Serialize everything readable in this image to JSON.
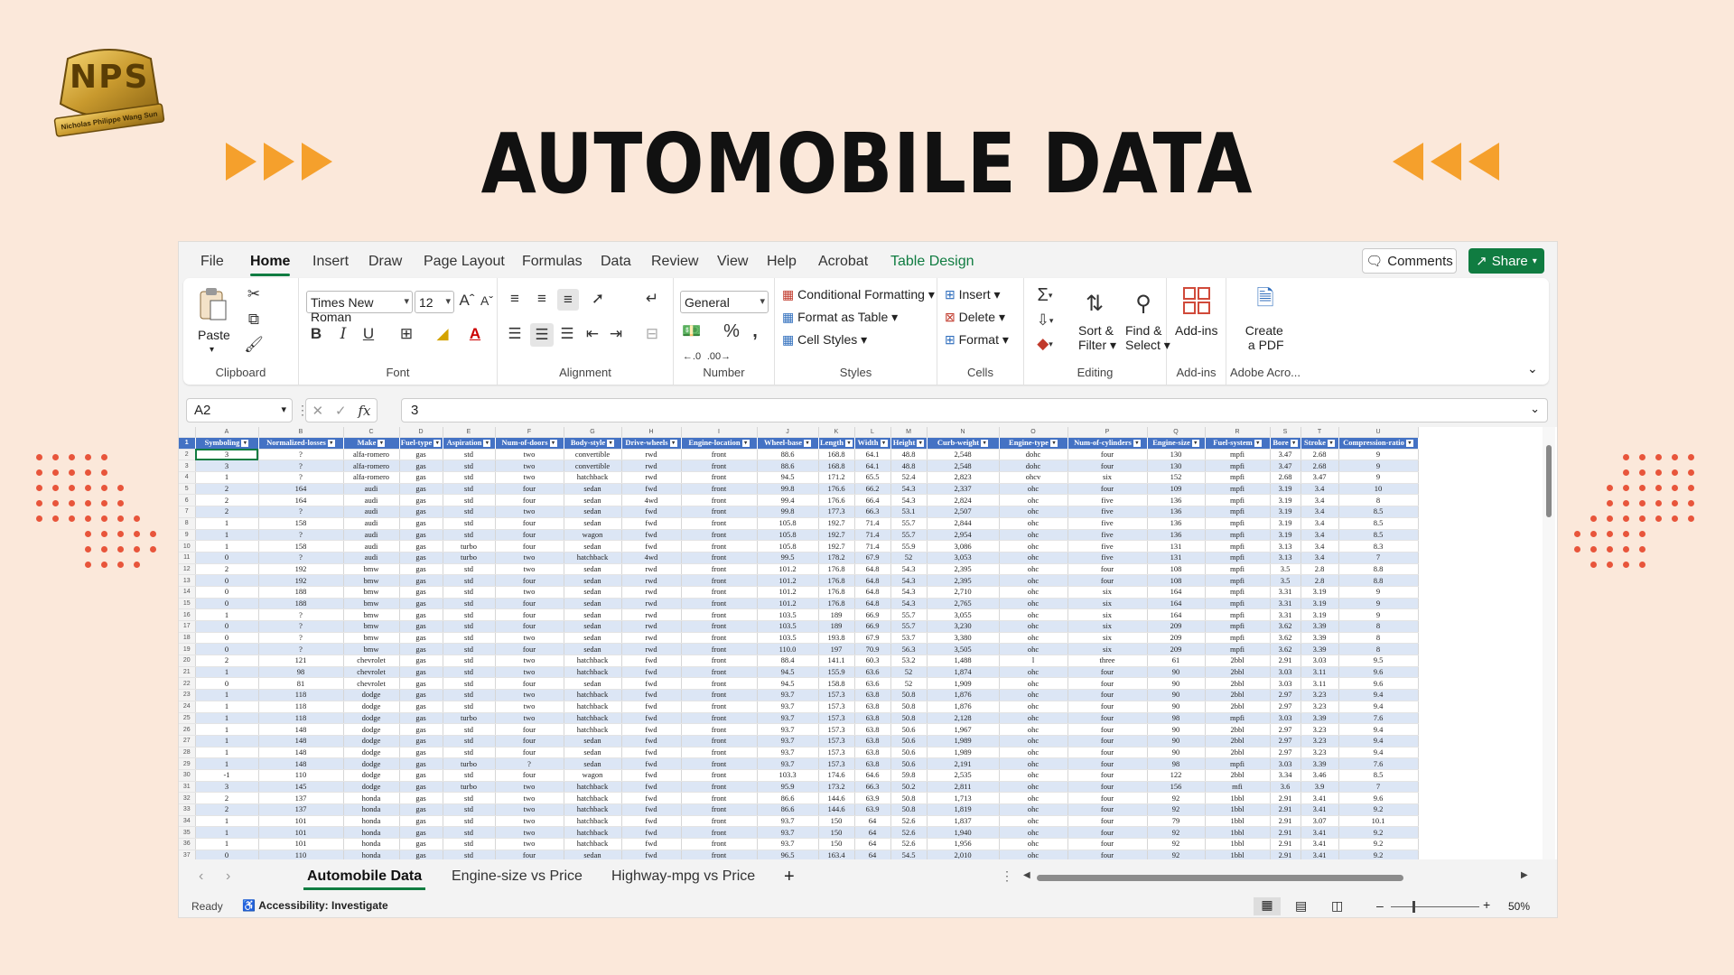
{
  "banner": {
    "title": "AUTOMOBILE DATA",
    "logo_text": "Nicholas Philippe Wang Sun",
    "logo_monogram": "NPS"
  },
  "menu": {
    "items": [
      "File",
      "Home",
      "Insert",
      "Draw",
      "Page Layout",
      "Formulas",
      "Data",
      "Review",
      "View",
      "Help",
      "Acrobat",
      "Table Design"
    ],
    "active": "Home",
    "comments_label": "Comments",
    "share_label": "Share"
  },
  "ribbon": {
    "clipboard": {
      "paste_label": "Paste",
      "group_label": "Clipboard"
    },
    "font": {
      "family": "Times New Roman",
      "size": "12",
      "group_label": "Font"
    },
    "alignment": {
      "group_label": "Alignment"
    },
    "number": {
      "format": "General",
      "group_label": "Number"
    },
    "styles": {
      "conditional": "Conditional Formatting",
      "format_table": "Format as Table",
      "cell_styles": "Cell Styles",
      "group_label": "Styles"
    },
    "cells": {
      "insert": "Insert",
      "delete": "Delete",
      "format": "Format",
      "group_label": "Cells"
    },
    "editing": {
      "sort_filter_1": "Sort &",
      "sort_filter_2": "Filter",
      "find_select_1": "Find &",
      "find_select_2": "Select",
      "group_label": "Editing"
    },
    "addins": {
      "label": "Add-ins",
      "group_label": "Add-ins"
    },
    "adobe": {
      "label1": "Create",
      "label2": "a PDF",
      "group_label": "Adobe Acro..."
    }
  },
  "formula_bar": {
    "name_box": "A2",
    "value": "3"
  },
  "grid": {
    "column_letters": [
      "A",
      "B",
      "C",
      "D",
      "E",
      "F",
      "G",
      "H",
      "I",
      "J",
      "K",
      "L",
      "M",
      "N",
      "O",
      "P",
      "Q",
      "R",
      "S",
      "T",
      "U"
    ],
    "headers": [
      "Symboling",
      "Normalized-losses",
      "Make",
      "Fuel-type",
      "Aspiration",
      "Num-of-doors",
      "Body-style",
      "Drive-wheels",
      "Engine-location",
      "Wheel-base",
      "Length",
      "Width",
      "Height",
      "Curb-weight",
      "Engine-type",
      "Num-of-cylinders",
      "Engine-size",
      "Fuel-system",
      "Bore",
      "Stroke",
      "Compression-ratio"
    ],
    "rows": [
      [
        "3",
        "?",
        "alfa-romero",
        "gas",
        "std",
        "two",
        "convertible",
        "rwd",
        "front",
        "88.6",
        "168.8",
        "64.1",
        "48.8",
        "2,548",
        "dohc",
        "four",
        "130",
        "mpfi",
        "3.47",
        "2.68",
        "9"
      ],
      [
        "3",
        "?",
        "alfa-romero",
        "gas",
        "std",
        "two",
        "convertible",
        "rwd",
        "front",
        "88.6",
        "168.8",
        "64.1",
        "48.8",
        "2,548",
        "dohc",
        "four",
        "130",
        "mpfi",
        "3.47",
        "2.68",
        "9"
      ],
      [
        "1",
        "?",
        "alfa-romero",
        "gas",
        "std",
        "two",
        "hatchback",
        "rwd",
        "front",
        "94.5",
        "171.2",
        "65.5",
        "52.4",
        "2,823",
        "ohcv",
        "six",
        "152",
        "mpfi",
        "2.68",
        "3.47",
        "9"
      ],
      [
        "2",
        "164",
        "audi",
        "gas",
        "std",
        "four",
        "sedan",
        "fwd",
        "front",
        "99.8",
        "176.6",
        "66.2",
        "54.3",
        "2,337",
        "ohc",
        "four",
        "109",
        "mpfi",
        "3.19",
        "3.4",
        "10"
      ],
      [
        "2",
        "164",
        "audi",
        "gas",
        "std",
        "four",
        "sedan",
        "4wd",
        "front",
        "99.4",
        "176.6",
        "66.4",
        "54.3",
        "2,824",
        "ohc",
        "five",
        "136",
        "mpfi",
        "3.19",
        "3.4",
        "8"
      ],
      [
        "2",
        "?",
        "audi",
        "gas",
        "std",
        "two",
        "sedan",
        "fwd",
        "front",
        "99.8",
        "177.3",
        "66.3",
        "53.1",
        "2,507",
        "ohc",
        "five",
        "136",
        "mpfi",
        "3.19",
        "3.4",
        "8.5"
      ],
      [
        "1",
        "158",
        "audi",
        "gas",
        "std",
        "four",
        "sedan",
        "fwd",
        "front",
        "105.8",
        "192.7",
        "71.4",
        "55.7",
        "2,844",
        "ohc",
        "five",
        "136",
        "mpfi",
        "3.19",
        "3.4",
        "8.5"
      ],
      [
        "1",
        "?",
        "audi",
        "gas",
        "std",
        "four",
        "wagon",
        "fwd",
        "front",
        "105.8",
        "192.7",
        "71.4",
        "55.7",
        "2,954",
        "ohc",
        "five",
        "136",
        "mpfi",
        "3.19",
        "3.4",
        "8.5"
      ],
      [
        "1",
        "158",
        "audi",
        "gas",
        "turbo",
        "four",
        "sedan",
        "fwd",
        "front",
        "105.8",
        "192.7",
        "71.4",
        "55.9",
        "3,086",
        "ohc",
        "five",
        "131",
        "mpfi",
        "3.13",
        "3.4",
        "8.3"
      ],
      [
        "0",
        "?",
        "audi",
        "gas",
        "turbo",
        "two",
        "hatchback",
        "4wd",
        "front",
        "99.5",
        "178.2",
        "67.9",
        "52",
        "3,053",
        "ohc",
        "five",
        "131",
        "mpfi",
        "3.13",
        "3.4",
        "7"
      ],
      [
        "2",
        "192",
        "bmw",
        "gas",
        "std",
        "two",
        "sedan",
        "rwd",
        "front",
        "101.2",
        "176.8",
        "64.8",
        "54.3",
        "2,395",
        "ohc",
        "four",
        "108",
        "mpfi",
        "3.5",
        "2.8",
        "8.8"
      ],
      [
        "0",
        "192",
        "bmw",
        "gas",
        "std",
        "four",
        "sedan",
        "rwd",
        "front",
        "101.2",
        "176.8",
        "64.8",
        "54.3",
        "2,395",
        "ohc",
        "four",
        "108",
        "mpfi",
        "3.5",
        "2.8",
        "8.8"
      ],
      [
        "0",
        "188",
        "bmw",
        "gas",
        "std",
        "two",
        "sedan",
        "rwd",
        "front",
        "101.2",
        "176.8",
        "64.8",
        "54.3",
        "2,710",
        "ohc",
        "six",
        "164",
        "mpfi",
        "3.31",
        "3.19",
        "9"
      ],
      [
        "0",
        "188",
        "bmw",
        "gas",
        "std",
        "four",
        "sedan",
        "rwd",
        "front",
        "101.2",
        "176.8",
        "64.8",
        "54.3",
        "2,765",
        "ohc",
        "six",
        "164",
        "mpfi",
        "3.31",
        "3.19",
        "9"
      ],
      [
        "1",
        "?",
        "bmw",
        "gas",
        "std",
        "four",
        "sedan",
        "rwd",
        "front",
        "103.5",
        "189",
        "66.9",
        "55.7",
        "3,055",
        "ohc",
        "six",
        "164",
        "mpfi",
        "3.31",
        "3.19",
        "9"
      ],
      [
        "0",
        "?",
        "bmw",
        "gas",
        "std",
        "four",
        "sedan",
        "rwd",
        "front",
        "103.5",
        "189",
        "66.9",
        "55.7",
        "3,230",
        "ohc",
        "six",
        "209",
        "mpfi",
        "3.62",
        "3.39",
        "8"
      ],
      [
        "0",
        "?",
        "bmw",
        "gas",
        "std",
        "two",
        "sedan",
        "rwd",
        "front",
        "103.5",
        "193.8",
        "67.9",
        "53.7",
        "3,380",
        "ohc",
        "six",
        "209",
        "mpfi",
        "3.62",
        "3.39",
        "8"
      ],
      [
        "0",
        "?",
        "bmw",
        "gas",
        "std",
        "four",
        "sedan",
        "rwd",
        "front",
        "110.0",
        "197",
        "70.9",
        "56.3",
        "3,505",
        "ohc",
        "six",
        "209",
        "mpfi",
        "3.62",
        "3.39",
        "8"
      ],
      [
        "2",
        "121",
        "chevrolet",
        "gas",
        "std",
        "two",
        "hatchback",
        "fwd",
        "front",
        "88.4",
        "141.1",
        "60.3",
        "53.2",
        "1,488",
        "l",
        "three",
        "61",
        "2bbl",
        "2.91",
        "3.03",
        "9.5"
      ],
      [
        "1",
        "98",
        "chevrolet",
        "gas",
        "std",
        "two",
        "hatchback",
        "fwd",
        "front",
        "94.5",
        "155.9",
        "63.6",
        "52",
        "1,874",
        "ohc",
        "four",
        "90",
        "2bbl",
        "3.03",
        "3.11",
        "9.6"
      ],
      [
        "0",
        "81",
        "chevrolet",
        "gas",
        "std",
        "four",
        "sedan",
        "fwd",
        "front",
        "94.5",
        "158.8",
        "63.6",
        "52",
        "1,909",
        "ohc",
        "four",
        "90",
        "2bbl",
        "3.03",
        "3.11",
        "9.6"
      ],
      [
        "1",
        "118",
        "dodge",
        "gas",
        "std",
        "two",
        "hatchback",
        "fwd",
        "front",
        "93.7",
        "157.3",
        "63.8",
        "50.8",
        "1,876",
        "ohc",
        "four",
        "90",
        "2bbl",
        "2.97",
        "3.23",
        "9.4"
      ],
      [
        "1",
        "118",
        "dodge",
        "gas",
        "std",
        "two",
        "hatchback",
        "fwd",
        "front",
        "93.7",
        "157.3",
        "63.8",
        "50.8",
        "1,876",
        "ohc",
        "four",
        "90",
        "2bbl",
        "2.97",
        "3.23",
        "9.4"
      ],
      [
        "1",
        "118",
        "dodge",
        "gas",
        "turbo",
        "two",
        "hatchback",
        "fwd",
        "front",
        "93.7",
        "157.3",
        "63.8",
        "50.8",
        "2,128",
        "ohc",
        "four",
        "98",
        "mpfi",
        "3.03",
        "3.39",
        "7.6"
      ],
      [
        "1",
        "148",
        "dodge",
        "gas",
        "std",
        "four",
        "hatchback",
        "fwd",
        "front",
        "93.7",
        "157.3",
        "63.8",
        "50.6",
        "1,967",
        "ohc",
        "four",
        "90",
        "2bbl",
        "2.97",
        "3.23",
        "9.4"
      ],
      [
        "1",
        "148",
        "dodge",
        "gas",
        "std",
        "four",
        "sedan",
        "fwd",
        "front",
        "93.7",
        "157.3",
        "63.8",
        "50.6",
        "1,989",
        "ohc",
        "four",
        "90",
        "2bbl",
        "2.97",
        "3.23",
        "9.4"
      ],
      [
        "1",
        "148",
        "dodge",
        "gas",
        "std",
        "four",
        "sedan",
        "fwd",
        "front",
        "93.7",
        "157.3",
        "63.8",
        "50.6",
        "1,989",
        "ohc",
        "four",
        "90",
        "2bbl",
        "2.97",
        "3.23",
        "9.4"
      ],
      [
        "1",
        "148",
        "dodge",
        "gas",
        "turbo",
        "?",
        "sedan",
        "fwd",
        "front",
        "93.7",
        "157.3",
        "63.8",
        "50.6",
        "2,191",
        "ohc",
        "four",
        "98",
        "mpfi",
        "3.03",
        "3.39",
        "7.6"
      ],
      [
        "-1",
        "110",
        "dodge",
        "gas",
        "std",
        "four",
        "wagon",
        "fwd",
        "front",
        "103.3",
        "174.6",
        "64.6",
        "59.8",
        "2,535",
        "ohc",
        "four",
        "122",
        "2bbl",
        "3.34",
        "3.46",
        "8.5"
      ],
      [
        "3",
        "145",
        "dodge",
        "gas",
        "turbo",
        "two",
        "hatchback",
        "fwd",
        "front",
        "95.9",
        "173.2",
        "66.3",
        "50.2",
        "2,811",
        "ohc",
        "four",
        "156",
        "mfi",
        "3.6",
        "3.9",
        "7"
      ],
      [
        "2",
        "137",
        "honda",
        "gas",
        "std",
        "two",
        "hatchback",
        "fwd",
        "front",
        "86.6",
        "144.6",
        "63.9",
        "50.8",
        "1,713",
        "ohc",
        "four",
        "92",
        "1bbl",
        "2.91",
        "3.41",
        "9.6"
      ],
      [
        "2",
        "137",
        "honda",
        "gas",
        "std",
        "two",
        "hatchback",
        "fwd",
        "front",
        "86.6",
        "144.6",
        "63.9",
        "50.8",
        "1,819",
        "ohc",
        "four",
        "92",
        "1bbl",
        "2.91",
        "3.41",
        "9.2"
      ],
      [
        "1",
        "101",
        "honda",
        "gas",
        "std",
        "two",
        "hatchback",
        "fwd",
        "front",
        "93.7",
        "150",
        "64",
        "52.6",
        "1,837",
        "ohc",
        "four",
        "79",
        "1bbl",
        "2.91",
        "3.07",
        "10.1"
      ],
      [
        "1",
        "101",
        "honda",
        "gas",
        "std",
        "two",
        "hatchback",
        "fwd",
        "front",
        "93.7",
        "150",
        "64",
        "52.6",
        "1,940",
        "ohc",
        "four",
        "92",
        "1bbl",
        "2.91",
        "3.41",
        "9.2"
      ],
      [
        "1",
        "101",
        "honda",
        "gas",
        "std",
        "two",
        "hatchback",
        "fwd",
        "front",
        "93.7",
        "150",
        "64",
        "52.6",
        "1,956",
        "ohc",
        "four",
        "92",
        "1bbl",
        "2.91",
        "3.41",
        "9.2"
      ],
      [
        "0",
        "110",
        "honda",
        "gas",
        "std",
        "four",
        "sedan",
        "fwd",
        "front",
        "96.5",
        "163.4",
        "64",
        "54.5",
        "2,010",
        "ohc",
        "four",
        "92",
        "1bbl",
        "2.91",
        "3.41",
        "9.2"
      ]
    ]
  },
  "sheets": {
    "tabs": [
      "Automobile Data",
      "Engine-size vs Price",
      "Highway-mpg vs Price"
    ],
    "active": 0
  },
  "statusbar": {
    "ready": "Ready",
    "accessibility": "Accessibility: Investigate",
    "zoom": "50%"
  },
  "colors": {
    "accent": "#107c41",
    "table_header": "#4472c4",
    "banner_bg": "#fbe8da",
    "arrows": "#f5a02c",
    "dots": "#e8553b"
  }
}
